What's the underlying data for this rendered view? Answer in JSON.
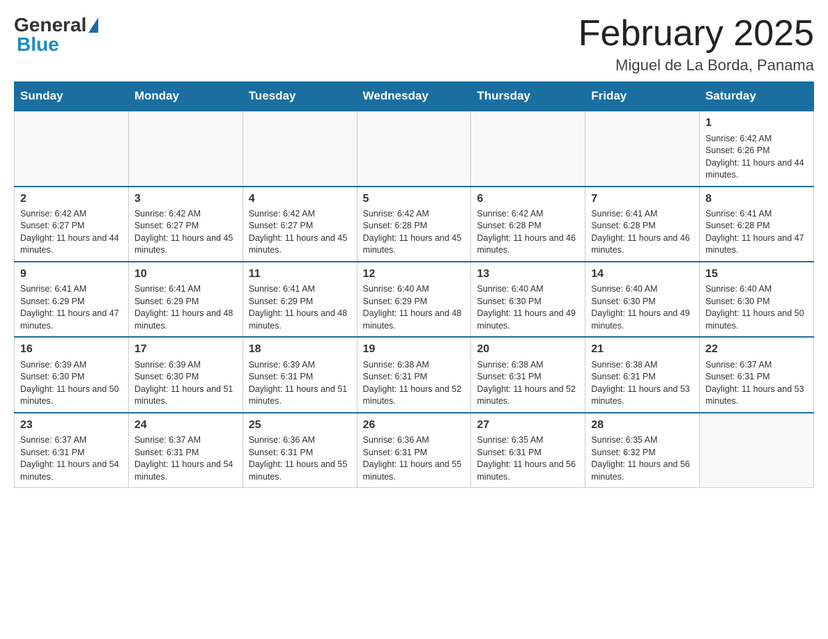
{
  "logo": {
    "general": "General",
    "blue": "Blue"
  },
  "title": "February 2025",
  "location": "Miguel de La Borda, Panama",
  "days_of_week": [
    "Sunday",
    "Monday",
    "Tuesday",
    "Wednesday",
    "Thursday",
    "Friday",
    "Saturday"
  ],
  "weeks": [
    [
      {
        "day": "",
        "sunrise": "",
        "sunset": "",
        "daylight": "",
        "empty": true
      },
      {
        "day": "",
        "sunrise": "",
        "sunset": "",
        "daylight": "",
        "empty": true
      },
      {
        "day": "",
        "sunrise": "",
        "sunset": "",
        "daylight": "",
        "empty": true
      },
      {
        "day": "",
        "sunrise": "",
        "sunset": "",
        "daylight": "",
        "empty": true
      },
      {
        "day": "",
        "sunrise": "",
        "sunset": "",
        "daylight": "",
        "empty": true
      },
      {
        "day": "",
        "sunrise": "",
        "sunset": "",
        "daylight": "",
        "empty": true
      },
      {
        "day": "1",
        "sunrise": "Sunrise: 6:42 AM",
        "sunset": "Sunset: 6:26 PM",
        "daylight": "Daylight: 11 hours and 44 minutes.",
        "empty": false
      }
    ],
    [
      {
        "day": "2",
        "sunrise": "Sunrise: 6:42 AM",
        "sunset": "Sunset: 6:27 PM",
        "daylight": "Daylight: 11 hours and 44 minutes.",
        "empty": false
      },
      {
        "day": "3",
        "sunrise": "Sunrise: 6:42 AM",
        "sunset": "Sunset: 6:27 PM",
        "daylight": "Daylight: 11 hours and 45 minutes.",
        "empty": false
      },
      {
        "day": "4",
        "sunrise": "Sunrise: 6:42 AM",
        "sunset": "Sunset: 6:27 PM",
        "daylight": "Daylight: 11 hours and 45 minutes.",
        "empty": false
      },
      {
        "day": "5",
        "sunrise": "Sunrise: 6:42 AM",
        "sunset": "Sunset: 6:28 PM",
        "daylight": "Daylight: 11 hours and 45 minutes.",
        "empty": false
      },
      {
        "day": "6",
        "sunrise": "Sunrise: 6:42 AM",
        "sunset": "Sunset: 6:28 PM",
        "daylight": "Daylight: 11 hours and 46 minutes.",
        "empty": false
      },
      {
        "day": "7",
        "sunrise": "Sunrise: 6:41 AM",
        "sunset": "Sunset: 6:28 PM",
        "daylight": "Daylight: 11 hours and 46 minutes.",
        "empty": false
      },
      {
        "day": "8",
        "sunrise": "Sunrise: 6:41 AM",
        "sunset": "Sunset: 6:28 PM",
        "daylight": "Daylight: 11 hours and 47 minutes.",
        "empty": false
      }
    ],
    [
      {
        "day": "9",
        "sunrise": "Sunrise: 6:41 AM",
        "sunset": "Sunset: 6:29 PM",
        "daylight": "Daylight: 11 hours and 47 minutes.",
        "empty": false
      },
      {
        "day": "10",
        "sunrise": "Sunrise: 6:41 AM",
        "sunset": "Sunset: 6:29 PM",
        "daylight": "Daylight: 11 hours and 48 minutes.",
        "empty": false
      },
      {
        "day": "11",
        "sunrise": "Sunrise: 6:41 AM",
        "sunset": "Sunset: 6:29 PM",
        "daylight": "Daylight: 11 hours and 48 minutes.",
        "empty": false
      },
      {
        "day": "12",
        "sunrise": "Sunrise: 6:40 AM",
        "sunset": "Sunset: 6:29 PM",
        "daylight": "Daylight: 11 hours and 48 minutes.",
        "empty": false
      },
      {
        "day": "13",
        "sunrise": "Sunrise: 6:40 AM",
        "sunset": "Sunset: 6:30 PM",
        "daylight": "Daylight: 11 hours and 49 minutes.",
        "empty": false
      },
      {
        "day": "14",
        "sunrise": "Sunrise: 6:40 AM",
        "sunset": "Sunset: 6:30 PM",
        "daylight": "Daylight: 11 hours and 49 minutes.",
        "empty": false
      },
      {
        "day": "15",
        "sunrise": "Sunrise: 6:40 AM",
        "sunset": "Sunset: 6:30 PM",
        "daylight": "Daylight: 11 hours and 50 minutes.",
        "empty": false
      }
    ],
    [
      {
        "day": "16",
        "sunrise": "Sunrise: 6:39 AM",
        "sunset": "Sunset: 6:30 PM",
        "daylight": "Daylight: 11 hours and 50 minutes.",
        "empty": false
      },
      {
        "day": "17",
        "sunrise": "Sunrise: 6:39 AM",
        "sunset": "Sunset: 6:30 PM",
        "daylight": "Daylight: 11 hours and 51 minutes.",
        "empty": false
      },
      {
        "day": "18",
        "sunrise": "Sunrise: 6:39 AM",
        "sunset": "Sunset: 6:31 PM",
        "daylight": "Daylight: 11 hours and 51 minutes.",
        "empty": false
      },
      {
        "day": "19",
        "sunrise": "Sunrise: 6:38 AM",
        "sunset": "Sunset: 6:31 PM",
        "daylight": "Daylight: 11 hours and 52 minutes.",
        "empty": false
      },
      {
        "day": "20",
        "sunrise": "Sunrise: 6:38 AM",
        "sunset": "Sunset: 6:31 PM",
        "daylight": "Daylight: 11 hours and 52 minutes.",
        "empty": false
      },
      {
        "day": "21",
        "sunrise": "Sunrise: 6:38 AM",
        "sunset": "Sunset: 6:31 PM",
        "daylight": "Daylight: 11 hours and 53 minutes.",
        "empty": false
      },
      {
        "day": "22",
        "sunrise": "Sunrise: 6:37 AM",
        "sunset": "Sunset: 6:31 PM",
        "daylight": "Daylight: 11 hours and 53 minutes.",
        "empty": false
      }
    ],
    [
      {
        "day": "23",
        "sunrise": "Sunrise: 6:37 AM",
        "sunset": "Sunset: 6:31 PM",
        "daylight": "Daylight: 11 hours and 54 minutes.",
        "empty": false
      },
      {
        "day": "24",
        "sunrise": "Sunrise: 6:37 AM",
        "sunset": "Sunset: 6:31 PM",
        "daylight": "Daylight: 11 hours and 54 minutes.",
        "empty": false
      },
      {
        "day": "25",
        "sunrise": "Sunrise: 6:36 AM",
        "sunset": "Sunset: 6:31 PM",
        "daylight": "Daylight: 11 hours and 55 minutes.",
        "empty": false
      },
      {
        "day": "26",
        "sunrise": "Sunrise: 6:36 AM",
        "sunset": "Sunset: 6:31 PM",
        "daylight": "Daylight: 11 hours and 55 minutes.",
        "empty": false
      },
      {
        "day": "27",
        "sunrise": "Sunrise: 6:35 AM",
        "sunset": "Sunset: 6:31 PM",
        "daylight": "Daylight: 11 hours and 56 minutes.",
        "empty": false
      },
      {
        "day": "28",
        "sunrise": "Sunrise: 6:35 AM",
        "sunset": "Sunset: 6:32 PM",
        "daylight": "Daylight: 11 hours and 56 minutes.",
        "empty": false
      },
      {
        "day": "",
        "sunrise": "",
        "sunset": "",
        "daylight": "",
        "empty": true
      }
    ]
  ]
}
